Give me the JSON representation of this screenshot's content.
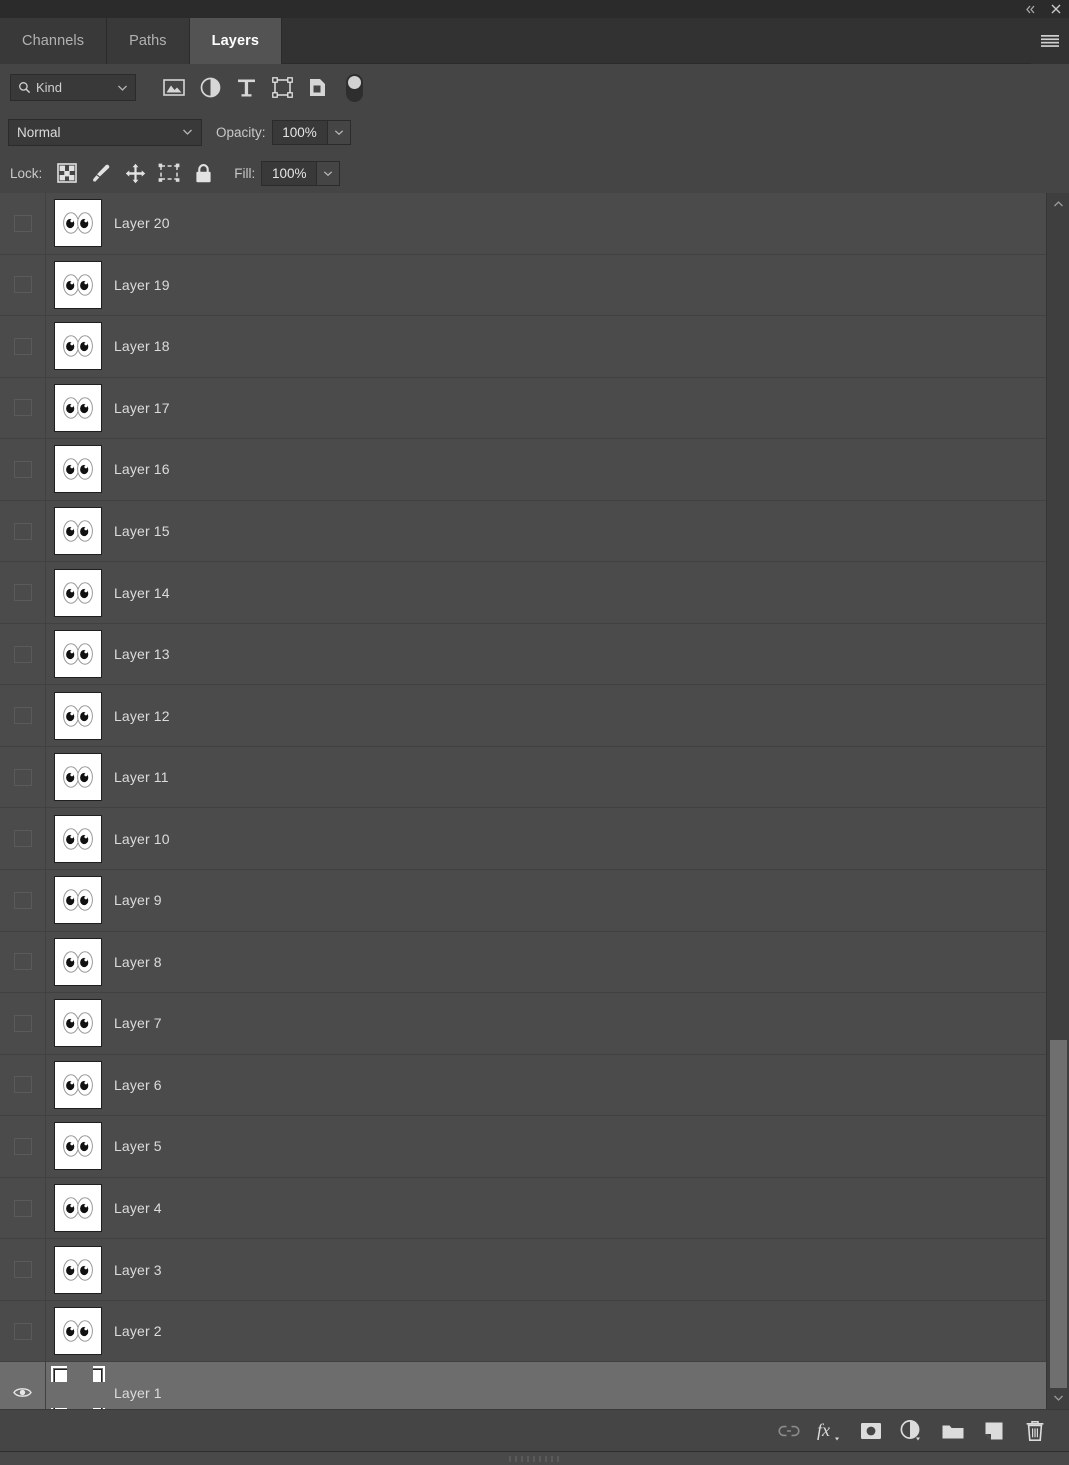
{
  "titlebar": {
    "collapse_label": "«",
    "close_label": "×",
    "icons": [
      "collapse-to-icons-icon",
      "close-icon"
    ]
  },
  "tabs": [
    {
      "label": "Channels",
      "active": false
    },
    {
      "label": "Paths",
      "active": false
    },
    {
      "label": "Layers",
      "active": true
    }
  ],
  "panel_menu": {
    "icon": "hamburger-menu-icon"
  },
  "filter_row": {
    "kind_label": "Kind",
    "search_icon": "search-icon",
    "chevron_icon": "chevron-down-icon",
    "type_filters": [
      {
        "name": "filter-pixel-layers",
        "icon": "image-icon"
      },
      {
        "name": "filter-adjustment-layers",
        "icon": "adjustment-half-circle-icon"
      },
      {
        "name": "filter-type-layers",
        "icon": "type-t-icon"
      },
      {
        "name": "filter-shape-layers",
        "icon": "shape-square-handles-icon"
      },
      {
        "name": "filter-smart-objects",
        "icon": "smart-object-icon"
      }
    ],
    "toggle": {
      "name": "filter-enable-toggle",
      "state": "on"
    }
  },
  "blend_row": {
    "blend_mode": "Normal",
    "opacity_label": "Opacity:",
    "opacity_value": "100%"
  },
  "lock_row": {
    "lock_label": "Lock:",
    "lock_icons": [
      {
        "name": "lock-transparent-pixels",
        "icon": "checkerboard-icon"
      },
      {
        "name": "lock-image-pixels",
        "icon": "brush-icon"
      },
      {
        "name": "lock-position",
        "icon": "move-arrows-icon"
      },
      {
        "name": "lock-artboard-nesting",
        "icon": "artboard-frame-icon"
      },
      {
        "name": "lock-all",
        "icon": "padlock-icon"
      }
    ],
    "fill_label": "Fill:",
    "fill_value": "100%"
  },
  "layers": [
    {
      "name": "Layer 20",
      "visible": false,
      "selected": false
    },
    {
      "name": "Layer 19",
      "visible": false,
      "selected": false
    },
    {
      "name": "Layer 18",
      "visible": false,
      "selected": false
    },
    {
      "name": "Layer 17",
      "visible": false,
      "selected": false
    },
    {
      "name": "Layer 16",
      "visible": false,
      "selected": false
    },
    {
      "name": "Layer 15",
      "visible": false,
      "selected": false
    },
    {
      "name": "Layer 14",
      "visible": false,
      "selected": false
    },
    {
      "name": "Layer 13",
      "visible": false,
      "selected": false
    },
    {
      "name": "Layer 12",
      "visible": false,
      "selected": false
    },
    {
      "name": "Layer 11",
      "visible": false,
      "selected": false
    },
    {
      "name": "Layer 10",
      "visible": false,
      "selected": false
    },
    {
      "name": "Layer 9",
      "visible": false,
      "selected": false
    },
    {
      "name": "Layer 8",
      "visible": false,
      "selected": false
    },
    {
      "name": "Layer 7",
      "visible": false,
      "selected": false
    },
    {
      "name": "Layer 6",
      "visible": false,
      "selected": false
    },
    {
      "name": "Layer 5",
      "visible": false,
      "selected": false
    },
    {
      "name": "Layer 4",
      "visible": false,
      "selected": false
    },
    {
      "name": "Layer 3",
      "visible": false,
      "selected": false
    },
    {
      "name": "Layer 2",
      "visible": false,
      "selected": false
    },
    {
      "name": "Layer 1",
      "visible": true,
      "selected": true
    }
  ],
  "thumbnail": {
    "description": "two-cartoon-eyes",
    "background": "#ffffff"
  },
  "scrollbar": {
    "up_icon": "chevron-up-icon",
    "down_icon": "chevron-down-icon"
  },
  "bottom_toolbar": [
    {
      "name": "link-layers-button",
      "icon": "link-chain-icon"
    },
    {
      "name": "layer-style-button",
      "icon": "fx-icon"
    },
    {
      "name": "add-layer-mask-button",
      "icon": "mask-circle-icon"
    },
    {
      "name": "new-adjustment-layer-button",
      "icon": "adjustment-half-circle-icon"
    },
    {
      "name": "new-group-button",
      "icon": "folder-icon"
    },
    {
      "name": "new-layer-button",
      "icon": "new-layer-page-icon"
    },
    {
      "name": "delete-layer-button",
      "icon": "trash-icon"
    }
  ],
  "resize_grip": {
    "icon": "resize-grip-icon"
  },
  "colors": {
    "panel_bg": "#454545",
    "list_bg": "#4b4b4b",
    "row_selected": "#6d6d6d",
    "tab_active": "#535353",
    "titlebar": "#2b2b2b",
    "text": "#dcdcdc",
    "field_bg": "#393939"
  }
}
